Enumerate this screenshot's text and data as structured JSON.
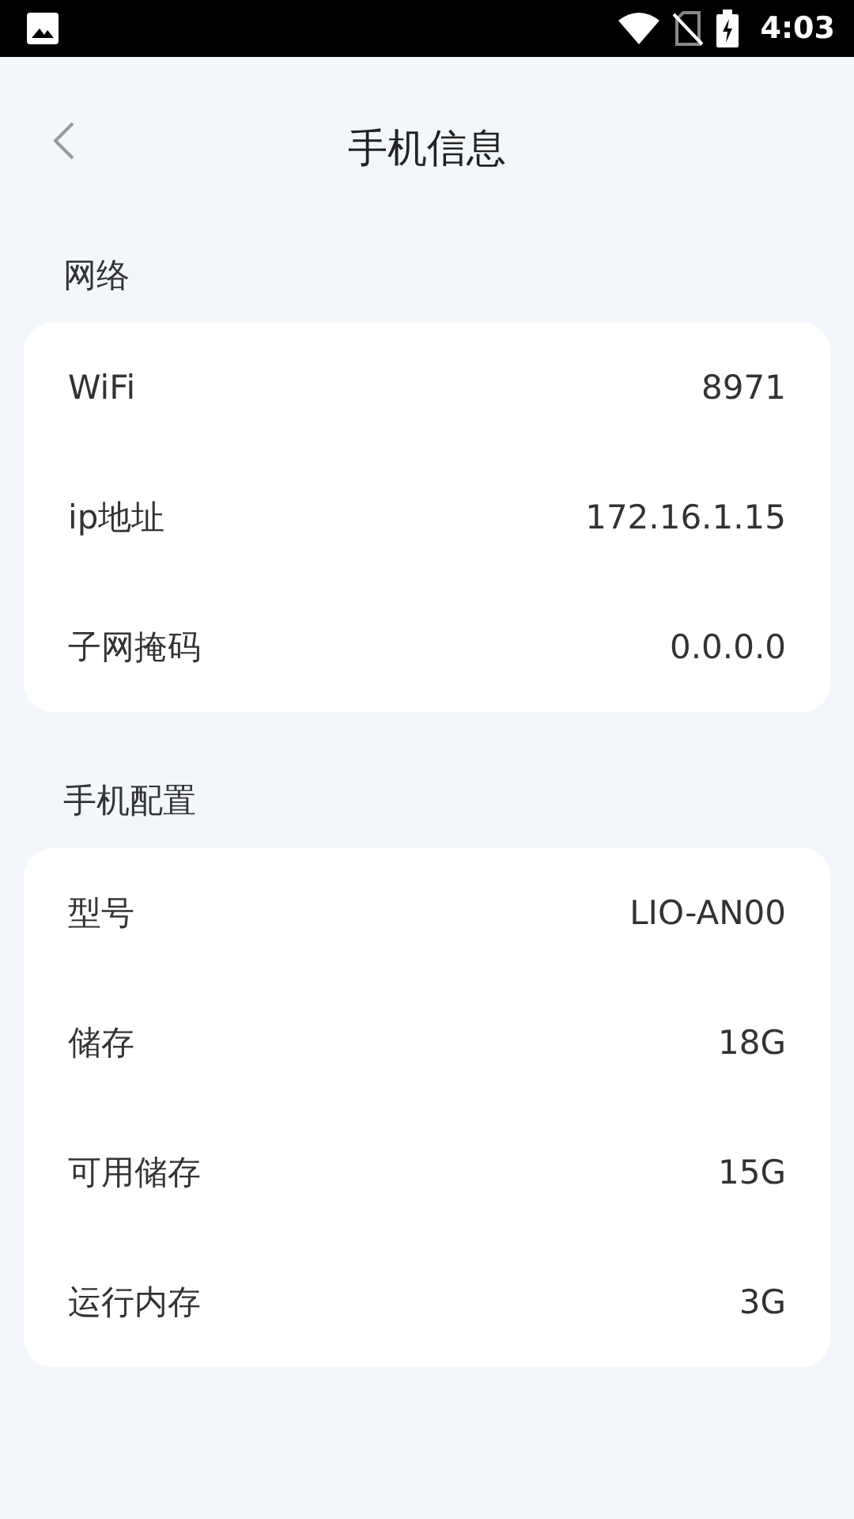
{
  "status_bar": {
    "time": "4:03"
  },
  "header": {
    "title": "手机信息"
  },
  "sections": [
    {
      "title": "网络",
      "rows": [
        {
          "label": "WiFi",
          "value": "8971"
        },
        {
          "label": "ip地址",
          "value": "172.16.1.15"
        },
        {
          "label": "子网掩码",
          "value": "0.0.0.0"
        }
      ]
    },
    {
      "title": "手机配置",
      "rows": [
        {
          "label": "型号",
          "value": "LIO-AN00"
        },
        {
          "label": "储存",
          "value": "18G"
        },
        {
          "label": "可用储存",
          "value": "15G"
        },
        {
          "label": "运行内存",
          "value": "3G"
        }
      ]
    }
  ]
}
